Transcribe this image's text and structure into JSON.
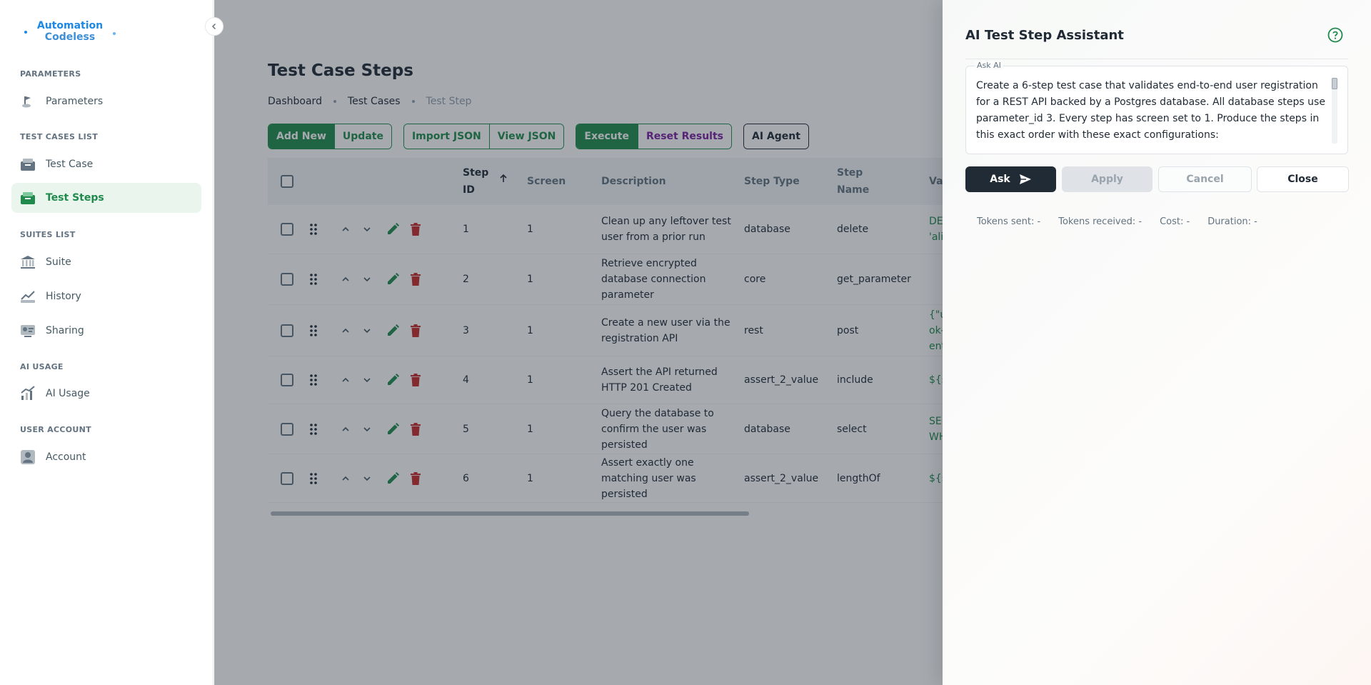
{
  "sidebar": {
    "logo_line1": "Automation",
    "logo_line2": "Codeless",
    "sections": [
      {
        "title": "PARAMETERS",
        "items": [
          {
            "label": "Parameters",
            "icon": "parameters-icon"
          }
        ]
      },
      {
        "title": "TEST CASES LIST",
        "items": [
          {
            "label": "Test Case",
            "icon": "test-case-icon"
          },
          {
            "label": "Test Steps",
            "icon": "test-steps-icon"
          }
        ]
      },
      {
        "title": "SUITES LIST",
        "items": [
          {
            "label": "Suite",
            "icon": "suite-icon"
          },
          {
            "label": "History",
            "icon": "history-icon"
          },
          {
            "label": "Sharing",
            "icon": "sharing-icon"
          }
        ]
      },
      {
        "title": "AI USAGE",
        "items": [
          {
            "label": "AI Usage",
            "icon": "ai-usage-icon"
          }
        ]
      },
      {
        "title": "USER ACCOUNT",
        "items": [
          {
            "label": "Account",
            "icon": "account-icon"
          }
        ]
      }
    ],
    "active_item": "Test Steps"
  },
  "main": {
    "title": "Test Case Steps",
    "breadcrumb": [
      "Dashboard",
      "Test Cases",
      "Test Step"
    ],
    "toolbar": {
      "add_new": "Add New",
      "update": "Update",
      "import_json": "Import JSON",
      "view_json": "View JSON",
      "execute": "Execute",
      "reset_results": "Reset Results",
      "ai_agent": "AI Agent"
    },
    "table": {
      "columns": [
        "Step ID",
        "Screen",
        "Description",
        "Step Type",
        "Step Name",
        "Val"
      ],
      "column_step_id_line1": "Step",
      "column_step_id_line2": "ID",
      "column_step_name_line1": "Step",
      "column_step_name_line2": "Name",
      "rows": [
        {
          "id": "1",
          "screen": "1",
          "desc_lines": [
            "Clean up any leftover test",
            "user from a prior run"
          ],
          "type": "database",
          "name": "delete",
          "val_lines": [
            "DE",
            "'ali"
          ]
        },
        {
          "id": "2",
          "screen": "1",
          "desc_lines": [
            "Retrieve encrypted",
            "database connection",
            "parameter"
          ],
          "type": "core",
          "name": "get_parameter",
          "val_lines": []
        },
        {
          "id": "3",
          "screen": "1",
          "desc_lines": [
            "Create a new user via the",
            "registration API"
          ],
          "type": "rest",
          "name": "post",
          "val_lines": [
            "{\"u",
            "ok-",
            "ent"
          ]
        },
        {
          "id": "4",
          "screen": "1",
          "desc_lines": [
            "Assert the API returned",
            "HTTP 201 Created"
          ],
          "type": "assert_2_value",
          "name": "include",
          "val_lines": [
            "${s"
          ]
        },
        {
          "id": "5",
          "screen": "1",
          "desc_lines": [
            "Query the database to",
            "confirm the user was",
            "persisted"
          ],
          "type": "database",
          "name": "select",
          "val_lines": [
            "SE",
            "WH"
          ]
        },
        {
          "id": "6",
          "screen": "1",
          "desc_lines": [
            "Assert exactly one",
            "matching user was",
            "persisted"
          ],
          "type": "assert_2_value",
          "name": "lengthOf",
          "val_lines": [
            "${s"
          ]
        }
      ]
    }
  },
  "drawer": {
    "title": "AI Test Step Assistant",
    "ask_label": "Ask AI",
    "ask_text_lines": [
      "Create a 6-step test case that validates end-to-end user registration",
      "for a REST API backed by a Postgres database. All database steps use",
      "parameter_id 3. Every step has screen set to 1. Produce the steps in",
      "this exact order with these exact configurations:"
    ],
    "buttons": {
      "ask": "Ask",
      "apply": "Apply",
      "cancel": "Cancel",
      "close": "Close"
    },
    "stats": [
      "Tokens sent: -",
      "Tokens received: -",
      "Cost: -",
      "Duration: -"
    ]
  },
  "colors": {
    "brand_green": "#1f8a4c",
    "delete_red": "#c62828",
    "dark": "#212b36",
    "logo_blue": "#1e88e5"
  }
}
